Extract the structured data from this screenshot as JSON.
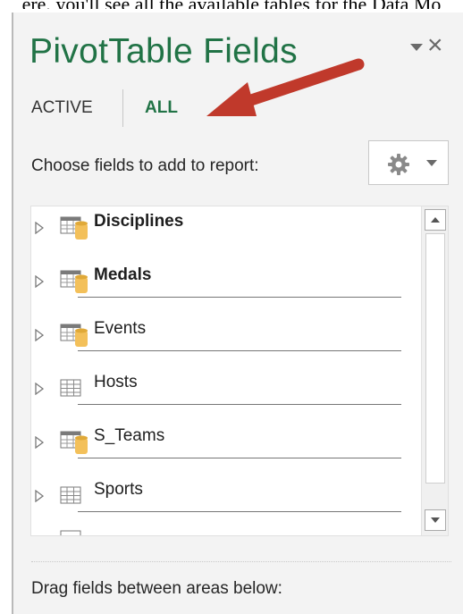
{
  "caption": "ere, you'll see all the available tables for the Data Mo",
  "pane": {
    "title": "PivotTable Fields",
    "options_icon": "chevron-down-icon",
    "close_icon": "close-icon",
    "close_glyph": "×"
  },
  "tabs": {
    "active_label": "ACTIVE",
    "all_label": "ALL",
    "selected": "ALL"
  },
  "annotation": {
    "arrow_color": "#c0392b",
    "icon": "red-arrow-icon"
  },
  "choose_label": "Choose fields to add to report:",
  "tools_button": {
    "icon": "gear-icon",
    "dropdown_icon": "chevron-down-icon"
  },
  "fields": [
    {
      "label": "Disciplines",
      "bold": true,
      "icon": "data-table-icon"
    },
    {
      "label": "Medals",
      "bold": true,
      "icon": "data-table-icon"
    },
    {
      "label": "Events",
      "bold": false,
      "icon": "data-table-icon"
    },
    {
      "label": "Hosts",
      "bold": false,
      "icon": "table-icon"
    },
    {
      "label": "S_Teams",
      "bold": false,
      "icon": "data-table-icon"
    },
    {
      "label": "Sports",
      "bold": false,
      "icon": "table-icon"
    }
  ],
  "drag_label": "Drag fields between areas below:",
  "colors": {
    "accent": "#217346",
    "pane_bg": "#f3f3f3",
    "cylinder": "#f3c05a"
  }
}
